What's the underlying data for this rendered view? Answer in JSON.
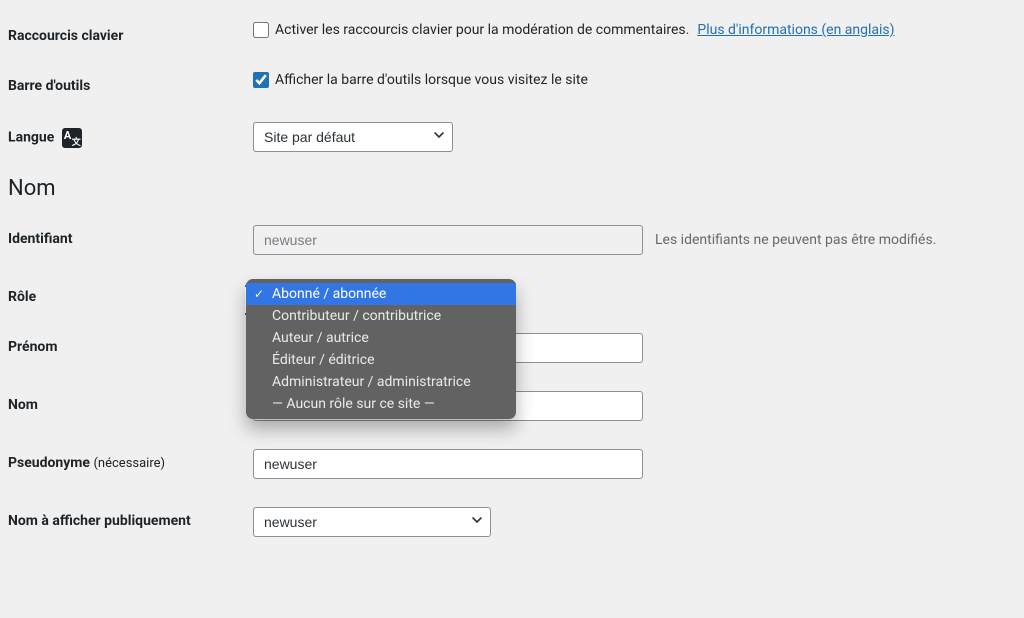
{
  "shortcuts": {
    "label": "Raccourcis clavier",
    "checkbox_label": "Activer les raccourcis clavier pour la modération de commentaires.",
    "link_text": "Plus d'informations (en anglais)",
    "checked": false
  },
  "toolbar": {
    "label": "Barre d'outils",
    "checkbox_label": "Afficher la barre d'outils lorsque vous visitez le site",
    "checked": true
  },
  "language": {
    "label": "Langue",
    "selected": "Site par défaut"
  },
  "name_section": "Nom",
  "username": {
    "label": "Identifiant",
    "value": "newuser",
    "desc": "Les identifiants ne peuvent pas être modifiés."
  },
  "role": {
    "label": "Rôle",
    "selected_index": 0,
    "options": [
      "Abonné / abonnée",
      "Contributeur / contributrice",
      "Auteur / autrice",
      "Éditeur / éditrice",
      "Administrateur / administratrice",
      "— Aucun rôle sur ce site —"
    ]
  },
  "firstname": {
    "label": "Prénom",
    "value": ""
  },
  "lastname": {
    "label": "Nom",
    "value": ""
  },
  "nickname": {
    "label": "Pseudonyme",
    "required": "(nécessaire)",
    "value": "newuser"
  },
  "display_name": {
    "label": "Nom à afficher publiquement",
    "selected": "newuser"
  }
}
